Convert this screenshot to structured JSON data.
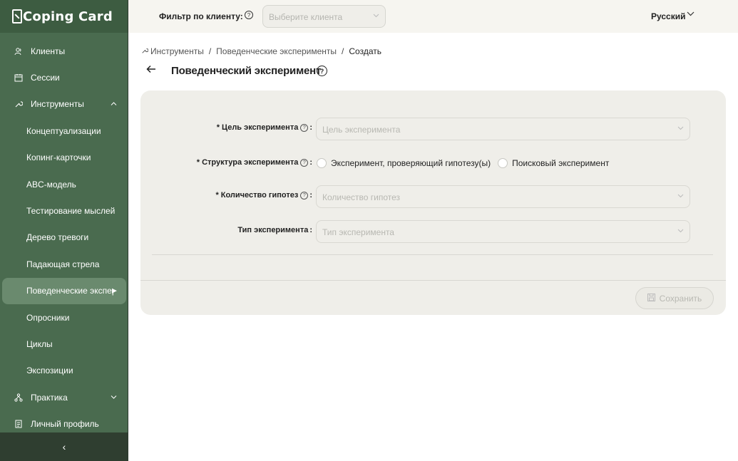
{
  "app": {
    "logo_text": "Coping Card"
  },
  "sidebar": {
    "items": [
      {
        "label": "Клиенты",
        "icon": "users-icon"
      },
      {
        "label": "Сессии",
        "icon": "calendar-icon"
      },
      {
        "label": "Инструменты",
        "icon": "tools-icon",
        "expanded": true
      },
      {
        "label": "Концептуализации"
      },
      {
        "label": "Копинг-карточки"
      },
      {
        "label": "ABC-модель"
      },
      {
        "label": "Тестирование мыслей"
      },
      {
        "label": "Дерево тревоги"
      },
      {
        "label": "Падающая стрела"
      },
      {
        "label": "Поведенческие экспери",
        "active": true
      },
      {
        "label": "Опросники"
      },
      {
        "label": "Циклы"
      },
      {
        "label": "Экспозиции"
      },
      {
        "label": "Практика",
        "icon": "practice-icon"
      },
      {
        "label": "Личный профиль",
        "icon": "profile-icon"
      }
    ],
    "collapse_glyph": "‹"
  },
  "header": {
    "filter_label": "Фильтр по клиенту:",
    "client_placeholder": "Выберите клиента",
    "language": "Русский"
  },
  "breadcrumb": {
    "items": [
      "Инструменты",
      "Поведенческие эксперименты",
      "Создать"
    ]
  },
  "page": {
    "title": "Поведенческий эксперимент"
  },
  "form": {
    "goal": {
      "label": "Цель эксперимента",
      "required": true,
      "placeholder": "Цель эксперимента"
    },
    "structure": {
      "label": "Структура эксперимента",
      "required": true,
      "options": [
        "Эксперимент, проверяющий гипотезу(ы)",
        "Поисковый эксперимент"
      ]
    },
    "hypotheses": {
      "label": "Количество гипотез",
      "required": true,
      "placeholder": "Количество гипотез"
    },
    "type": {
      "label": "Тип эксперимента",
      "required": false,
      "placeholder": "Тип эксперимента"
    },
    "save_label": "Сохранить"
  },
  "colors": {
    "sidebar_bg": "#4a6b4f",
    "sidebar_active": "#6a8a6e",
    "header_bg": "#f6f5f0",
    "card_bg": "#efeee9"
  }
}
